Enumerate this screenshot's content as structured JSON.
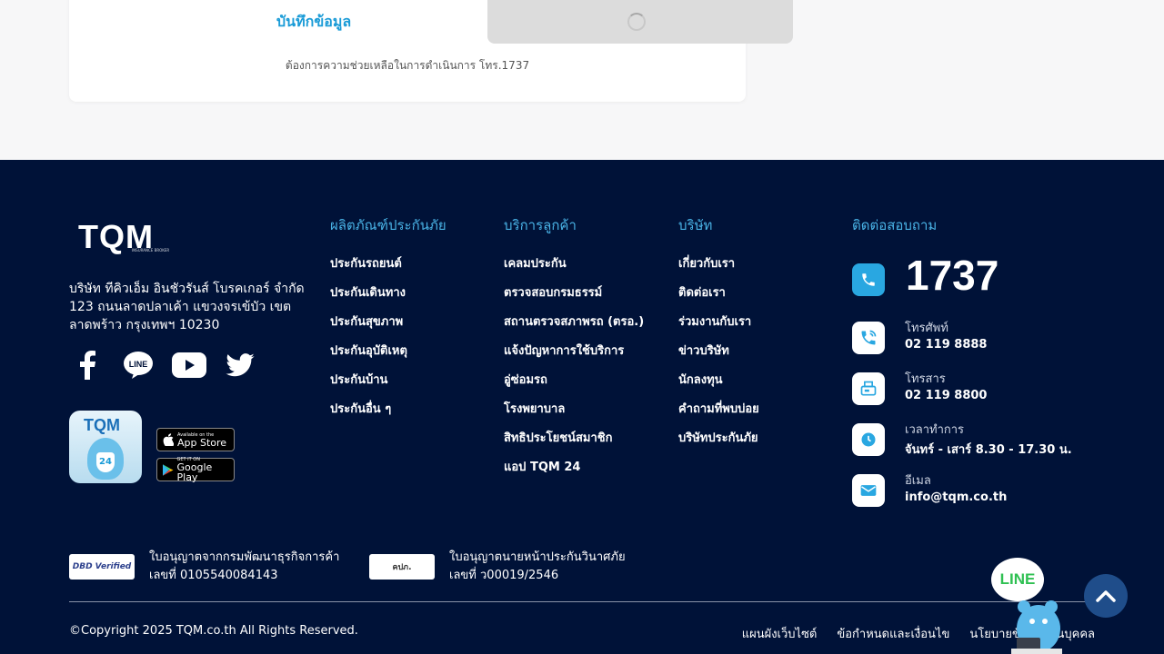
{
  "form": {
    "save_link": "บันทึกข้อมูล",
    "help_text": "ต้องการความช่วยเหลือในการดำเนินการ โทร.1737"
  },
  "footer": {
    "logo_text": "TQM",
    "logo_sub": "INSURANCE BROKER",
    "company_address": "บริษัท ทีคิวเอ็ม อินชัวรันส์ โบรคเกอร์ จำกัด 123 ถนนลาดปลาเค้า แขวงจรเข้บัว เขตลาดพร้าว กรุงเทพฯ 10230",
    "social": [
      "facebook-icon",
      "line-icon",
      "youtube-icon",
      "twitter-icon"
    ],
    "app_icon_text": "TQM",
    "app_icon_badge": "24",
    "app_store": {
      "small": "Available on the",
      "big": "App Store"
    },
    "google_play": {
      "small": "GET IT ON",
      "big": "Google Play"
    },
    "columns": [
      {
        "title": "ผลิตภัณฑ์ประกันภัย",
        "links": [
          "ประกันรถยนต์",
          "ประกันเดินทาง",
          "ประกันสุขภาพ",
          "ประกันอุบัติเหตุ",
          "ประกันบ้าน",
          "ประกันอื่น ๆ"
        ]
      },
      {
        "title": "บริการลูกค้า",
        "links": [
          "เคลมประกัน",
          "ตรวจสอบกรมธรรม์",
          "สถานตรวจสภาพรถ (ตรอ.)",
          "แจ้งปัญหาการใช้บริการ",
          "อู่ซ่อมรถ",
          "โรงพยาบาล",
          "สิทธิประโยชน์สมาชิก",
          "แอป TQM 24"
        ]
      },
      {
        "title": "บริษัท",
        "links": [
          "เกี่ยวกับเรา",
          "ติดต่อเรา",
          "ร่วมงานกับเรา",
          "ข่าวบริษัท",
          "นักลงทุน",
          "คำถามที่พบบ่อย",
          "บริษัทประกันภัย"
        ]
      }
    ],
    "contact": {
      "title": "ติดต่อสอบถาม",
      "hotline": "1737",
      "phone_label": "โทรศัพท์",
      "phone": "02 119 8888",
      "fax_label": "โทรสาร",
      "fax": "02 119 8800",
      "hours_label": "เวลาทำการ",
      "hours": "จันทร์ - เสาร์ 8.30 - 17.30 น.",
      "email_label": "อีเมล",
      "email": "info@tqm.co.th"
    },
    "licenses": [
      {
        "badge": "DBD Verified",
        "line1": "ใบอนุญาตจากกรมพัฒนาธุรกิจการค้า",
        "line2": "เลขที่ 0105540084143"
      },
      {
        "badge": "คปภ.",
        "line1": "ใบอนุญาตนายหน้าประกันวินาศภัย",
        "line2": "เลขที่ ว00019/2546"
      }
    ],
    "copyright": "©Copyright 2025 TQM.co.th All Rights Reserved.",
    "bottom_links": [
      "แผนผังเว็บไซต์",
      "ข้อกำหนดและเงื่อนไข",
      "นโยบายข้อมูลส่วนบุคคล"
    ],
    "line_chat": "LINE"
  },
  "colors": {
    "footer_bg": "#001238",
    "accent": "#49b3e6",
    "link_blue": "#1a9bd7"
  }
}
